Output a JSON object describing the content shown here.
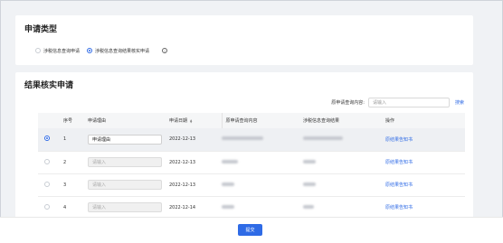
{
  "apply_type": {
    "title": "申请类型",
    "options": [
      {
        "label": "涉税信息查询申请",
        "checked": false
      },
      {
        "label": "涉税信息查询结果核实申请",
        "checked": true
      }
    ],
    "info_icon": "ⓘ"
  },
  "verify": {
    "title": "结果核实申请",
    "query_label": "原申请查询内容:",
    "query_placeholder": "请输入",
    "search_label": "搜索",
    "columns": [
      "序号",
      "申请理由",
      "申请日期",
      "原申请查询内容",
      "涉税信息查询结果",
      "操作"
    ],
    "rows": [
      {
        "no": "1",
        "reason": "申请理由",
        "reason_filled": true,
        "date": "2022-12-13",
        "op": "原结果告知书",
        "selected": true
      },
      {
        "no": "2",
        "reason": "请输入",
        "reason_filled": false,
        "date": "2022-12-13",
        "op": "原结果告知书",
        "selected": false
      },
      {
        "no": "3",
        "reason": "请输入",
        "reason_filled": false,
        "date": "2022-12-13",
        "op": "原结果告知书",
        "selected": false
      },
      {
        "no": "4",
        "reason": "请输入",
        "reason_filled": false,
        "date": "2022-12-14",
        "op": "原结果告知书",
        "selected": false
      }
    ]
  },
  "footer": {
    "submit_label": "提交"
  },
  "colors": {
    "primary": "#2f6be6",
    "selected_row": "#eef0f3"
  }
}
